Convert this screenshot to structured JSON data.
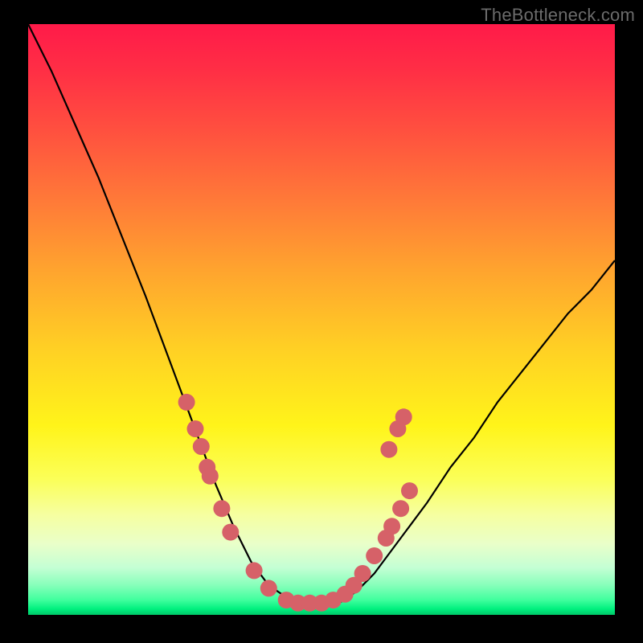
{
  "watermark": "TheBottleneck.com",
  "colors": {
    "frame": "#000000",
    "watermark_text": "#6b6b6b",
    "curve": "#000000",
    "dots": "#d66168"
  },
  "chart_data": {
    "type": "line",
    "title": "",
    "xlabel": "",
    "ylabel": "",
    "xlim": [
      0,
      100
    ],
    "ylim": [
      0,
      100
    ],
    "grid": false,
    "legend": false,
    "note": "Axes carry no tick labels in the source image; x and y are normalized 0–100. y≈100 at top-left, descends to a flat minimum near y≈2 around x≈40–54, then rises toward y≈60 at x=100.",
    "series": [
      {
        "name": "curve",
        "x": [
          0,
          4,
          8,
          12,
          16,
          20,
          23,
          26,
          29,
          32,
          35,
          38,
          41,
          44,
          47,
          50,
          53,
          56,
          59,
          62,
          65,
          68,
          72,
          76,
          80,
          84,
          88,
          92,
          96,
          100
        ],
        "values": [
          100,
          92,
          83,
          74,
          64,
          54,
          46,
          38,
          30,
          22,
          15,
          9,
          5,
          3,
          2,
          2,
          2,
          4,
          7,
          11,
          15,
          19,
          25,
          30,
          36,
          41,
          46,
          51,
          55,
          60
        ]
      }
    ],
    "markers": [
      {
        "x": 27.0,
        "y": 36.0
      },
      {
        "x": 28.5,
        "y": 31.5
      },
      {
        "x": 29.5,
        "y": 28.5
      },
      {
        "x": 30.5,
        "y": 25.0
      },
      {
        "x": 31.0,
        "y": 23.5
      },
      {
        "x": 33.0,
        "y": 18.0
      },
      {
        "x": 34.5,
        "y": 14.0
      },
      {
        "x": 38.5,
        "y": 7.5
      },
      {
        "x": 41.0,
        "y": 4.5
      },
      {
        "x": 44.0,
        "y": 2.5
      },
      {
        "x": 46.0,
        "y": 2.0
      },
      {
        "x": 48.0,
        "y": 2.0
      },
      {
        "x": 50.0,
        "y": 2.0
      },
      {
        "x": 52.0,
        "y": 2.5
      },
      {
        "x": 54.0,
        "y": 3.5
      },
      {
        "x": 55.5,
        "y": 5.0
      },
      {
        "x": 57.0,
        "y": 7.0
      },
      {
        "x": 59.0,
        "y": 10.0
      },
      {
        "x": 61.0,
        "y": 13.0
      },
      {
        "x": 62.0,
        "y": 15.0
      },
      {
        "x": 63.5,
        "y": 18.0
      },
      {
        "x": 65.0,
        "y": 21.0
      },
      {
        "x": 61.5,
        "y": 28.0
      },
      {
        "x": 63.0,
        "y": 31.5
      },
      {
        "x": 64.0,
        "y": 33.5
      }
    ]
  }
}
